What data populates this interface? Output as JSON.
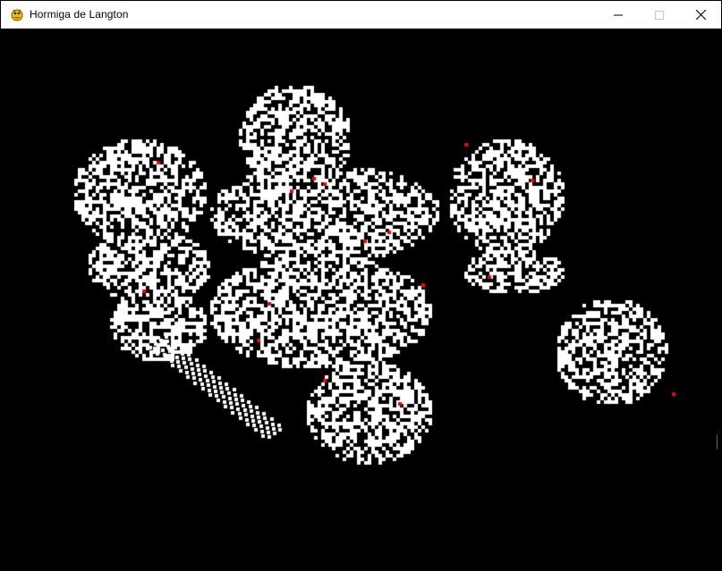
{
  "window": {
    "title": "Hormiga de Langton",
    "app_icon": "pygame-snake-icon",
    "controls": {
      "minimize_icon": "minimize-icon",
      "maximize_icon": "maximize-icon",
      "close_icon": "close-icon"
    }
  },
  "simulation": {
    "background_color": "#000000",
    "cell_color": "#ffffff",
    "ant_color": "#ff0000"
  }
}
